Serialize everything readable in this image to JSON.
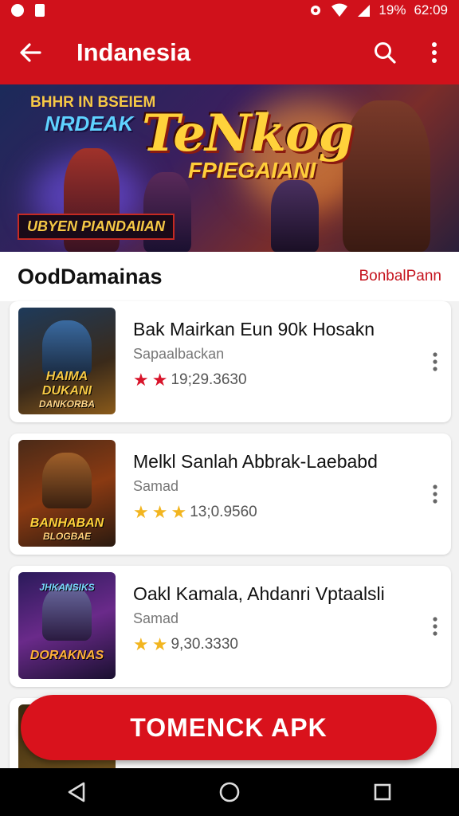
{
  "status_bar": {
    "battery_text": "19%",
    "time": "62:09"
  },
  "app_bar": {
    "title": "Indanesia"
  },
  "banner": {
    "top_text_1": "BHHR IN BSEIEM",
    "top_text_2": "NRDEAK",
    "title": "TeNkog",
    "subtitle": "FPIEGAIANI",
    "tag": "UBYEN PIANDAIIAN"
  },
  "section": {
    "title": "OodDamainas",
    "more_link": "BonbalPann"
  },
  "items": [
    {
      "name": "Bak Mairkan Eun 90k Hosakn",
      "sub": "Sapaalbackan",
      "rating_text": "19;29.3630",
      "star_color": "#d8142a",
      "thumb_text": "HAIMA DUKANI",
      "thumb_footer": "DANKORBA"
    },
    {
      "name": "Melkl Sanlah Abbrak-Laebabd",
      "sub": "Samad",
      "rating_text": "13;0.9560",
      "star_color": "#f2b51f",
      "thumb_text": "BANHABAN",
      "thumb_footer": "BLOGBAE"
    },
    {
      "name": "Oakl Kamala, Ahdanri Vptaalsli",
      "sub": "Samad",
      "rating_text": "9,30.3330",
      "star_color": "#f2b51f",
      "thumb_text": "DORAKNAS",
      "thumb_footer": "JHKANSIKS"
    }
  ],
  "cta": {
    "label": "TOMENCK APK"
  },
  "colors": {
    "primary": "#d0111b",
    "accent_text": "#c5141e"
  }
}
